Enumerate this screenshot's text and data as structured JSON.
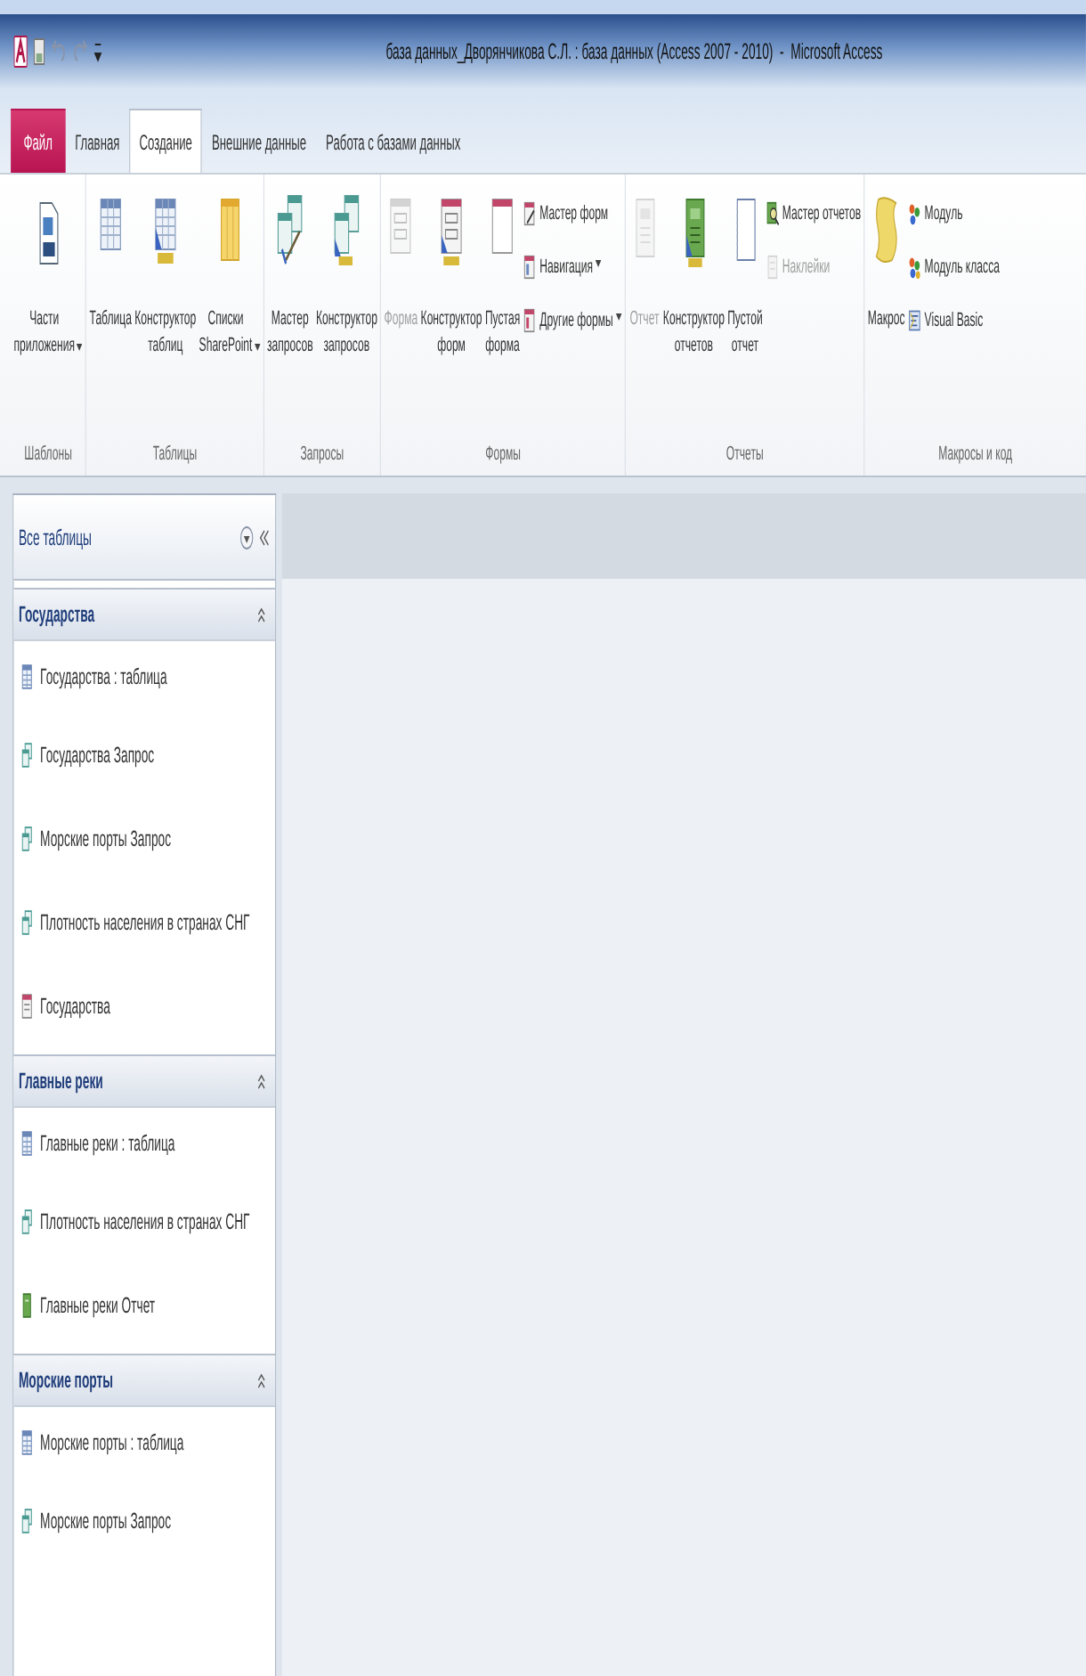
{
  "title_bar": {
    "title": "база данных_Дворянчикова С.Л. : база данных (Access 2007 - 2010)  -  Microsoft Access"
  },
  "tabs": [
    {
      "label": "Файл",
      "kind": "file",
      "selected": false
    },
    {
      "label": "Главная",
      "kind": "tab",
      "selected": false
    },
    {
      "label": "Создание",
      "kind": "tab",
      "selected": true
    },
    {
      "label": "Внешние данные",
      "kind": "tab",
      "selected": false
    },
    {
      "label": "Работа с базами данных",
      "kind": "tab",
      "selected": false
    }
  ],
  "ribbon": {
    "groups": [
      {
        "label": "Шаблоны",
        "items": [
          {
            "kind": "large",
            "label": "Части приложения",
            "dropdown": true,
            "disabled": false
          }
        ]
      },
      {
        "label": "Таблицы",
        "items": [
          {
            "kind": "large",
            "label": "Таблица",
            "dropdown": false,
            "disabled": false
          },
          {
            "kind": "large",
            "label": "Конструктор таблиц",
            "dropdown": false,
            "disabled": false
          },
          {
            "kind": "large",
            "label": "Списки SharePoint",
            "dropdown": true,
            "disabled": false
          }
        ]
      },
      {
        "label": "Запросы",
        "items": [
          {
            "kind": "large",
            "label": "Мастер запросов",
            "dropdown": false,
            "disabled": false
          },
          {
            "kind": "large",
            "label": "Конструктор запросов",
            "dropdown": false,
            "disabled": false
          }
        ]
      },
      {
        "label": "Формы",
        "items": [
          {
            "kind": "large",
            "label": "Форма",
            "dropdown": false,
            "disabled": true
          },
          {
            "kind": "large",
            "label": "Конструктор форм",
            "dropdown": false,
            "disabled": false
          },
          {
            "kind": "large",
            "label": "Пустая форма",
            "dropdown": false,
            "disabled": false
          },
          {
            "kind": "small",
            "label": "Мастер форм",
            "dropdown": false,
            "disabled": false
          },
          {
            "kind": "small",
            "label": "Навигация",
            "dropdown": true,
            "disabled": false
          },
          {
            "kind": "small",
            "label": "Другие формы",
            "dropdown": true,
            "disabled": false
          }
        ]
      },
      {
        "label": "Отчеты",
        "items": [
          {
            "kind": "large",
            "label": "Отчет",
            "dropdown": false,
            "disabled": true
          },
          {
            "kind": "large",
            "label": "Конструктор отчетов",
            "dropdown": false,
            "disabled": false
          },
          {
            "kind": "large",
            "label": "Пустой отчет",
            "dropdown": false,
            "disabled": false
          },
          {
            "kind": "small",
            "label": "Мастер отчетов",
            "dropdown": false,
            "disabled": false
          },
          {
            "kind": "small",
            "label": "Наклейки",
            "dropdown": false,
            "disabled": true
          }
        ]
      },
      {
        "label": "Макросы и код",
        "items": [
          {
            "kind": "large",
            "label": "Макрос",
            "dropdown": false,
            "disabled": false
          },
          {
            "kind": "small",
            "label": "Модуль",
            "dropdown": false,
            "disabled": false
          },
          {
            "kind": "small",
            "label": "Модуль класса",
            "dropdown": false,
            "disabled": false
          },
          {
            "kind": "small",
            "label": "Visual Basic",
            "dropdown": false,
            "disabled": false
          }
        ]
      }
    ]
  },
  "navigation_pane": {
    "title": "Все таблицы",
    "groups": [
      {
        "title": "Государства",
        "expanded": true,
        "items": [
          {
            "kind": "table",
            "label": "Государства : таблица"
          },
          {
            "kind": "query",
            "label": "Государства Запрос"
          },
          {
            "kind": "query",
            "label": "Морские порты Запрос"
          },
          {
            "kind": "query",
            "label": "Плотность населения в странах СНГ"
          },
          {
            "kind": "form",
            "label": "Государства"
          }
        ]
      },
      {
        "title": "Главные реки",
        "expanded": true,
        "items": [
          {
            "kind": "table",
            "label": "Главные реки : таблица"
          },
          {
            "kind": "query",
            "label": "Плотность населения в странах СНГ"
          },
          {
            "kind": "report",
            "label": "Главные реки Отчет"
          }
        ]
      },
      {
        "title": "Морские порты",
        "expanded": true,
        "items": [
          {
            "kind": "table",
            "label": "Морские порты : таблица"
          },
          {
            "kind": "query",
            "label": "Морские порты Запрос"
          }
        ]
      }
    ]
  }
}
